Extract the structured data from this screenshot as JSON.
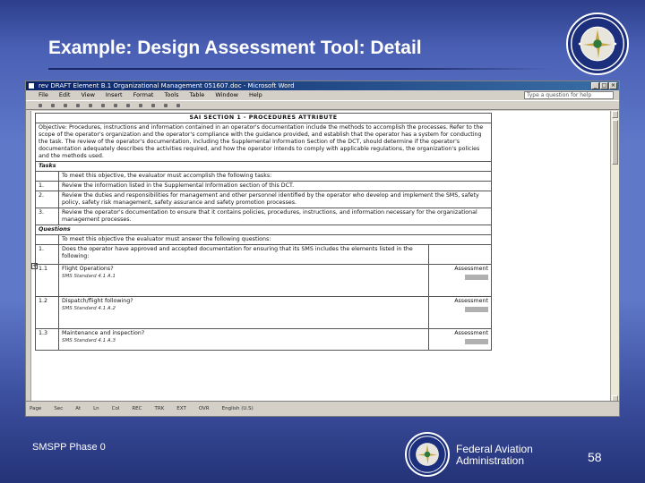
{
  "slide": {
    "title": "Example: Design Assessment Tool:  Detail",
    "footer_left": "SMSPP Phase 0",
    "org_line1": "Federal Aviation",
    "org_line2": "Administration",
    "page_number": "58",
    "seal_text": "FEDERAL AVIATION ADMINISTRATION"
  },
  "word": {
    "window_title": "rev DRAFT Element B.1 Organizational Management 051607.doc - Microsoft Word",
    "menu": [
      "File",
      "Edit",
      "View",
      "Insert",
      "Format",
      "Tools",
      "Table",
      "Window",
      "Help"
    ],
    "question_box": "Type a question for help",
    "status": [
      "Page",
      "Sec",
      "At",
      "Ln",
      "Col",
      "REC",
      "TRK",
      "EXT",
      "OVR",
      "English (U.S)"
    ],
    "doc": {
      "section_heading": "SAI SECTION 1 - PROCEDURES ATTRIBUTE",
      "objective": "Objective: Procedures, instructions and information contained in an operator's documentation include the methods to accomplish the processes. Refer to the scope of the operator's organization and the operator's compliance with the guidance provided, and establish that the operator has a system for conducting the task. The review of the operator's documentation, including the Supplemental Information Section of the DCT, should determine if the operator's documentation adequately describes the activities required, and how the operator intends to comply with applicable regulations, the organization's policies and the methods used.",
      "tasks_label": "Tasks",
      "tasks_intro": "To meet this objective, the evaluator must accomplish the following tasks:",
      "tasks": [
        {
          "num": "1.",
          "text": "Review the information listed in the Supplemental Information section of this DCT."
        },
        {
          "num": "2.",
          "text": "Review the duties and responsibilities for management and other personnel identified by the operator who develop and implement the SMS, safety policy, safety risk management, safety assurance and safety promotion processes."
        },
        {
          "num": "3.",
          "text": "Review the operator's documentation to ensure that it contains policies, procedures, instructions, and information necessary for the organizational management processes."
        }
      ],
      "questions_label": "Questions",
      "questions_intro": "To meet this objective the evaluator must answer the following questions:",
      "questions": [
        {
          "num": "1.",
          "text": "Does the operator have approved and accepted documentation for ensuring that its SMS includes the elements listed in the following:",
          "sub": "",
          "assess": ""
        },
        {
          "num": "1.1",
          "text": "Flight Operations?",
          "sub": "SMS Standard 4.1 A.1",
          "assess": "Assessment"
        },
        {
          "num": "1.2",
          "text": "Dispatch/flight following?",
          "sub": "SMS Standard 4.1 A.2",
          "assess": "Assessment"
        },
        {
          "num": "1.3",
          "text": "Maintenance and inspection?",
          "sub": "SMS Standard 4.1 A.3",
          "assess": "Assessment"
        }
      ]
    }
  },
  "colors": {
    "slide_blue": "#5f78c8",
    "title_bar": "#0a246a",
    "seal": "#1c2f7c"
  }
}
